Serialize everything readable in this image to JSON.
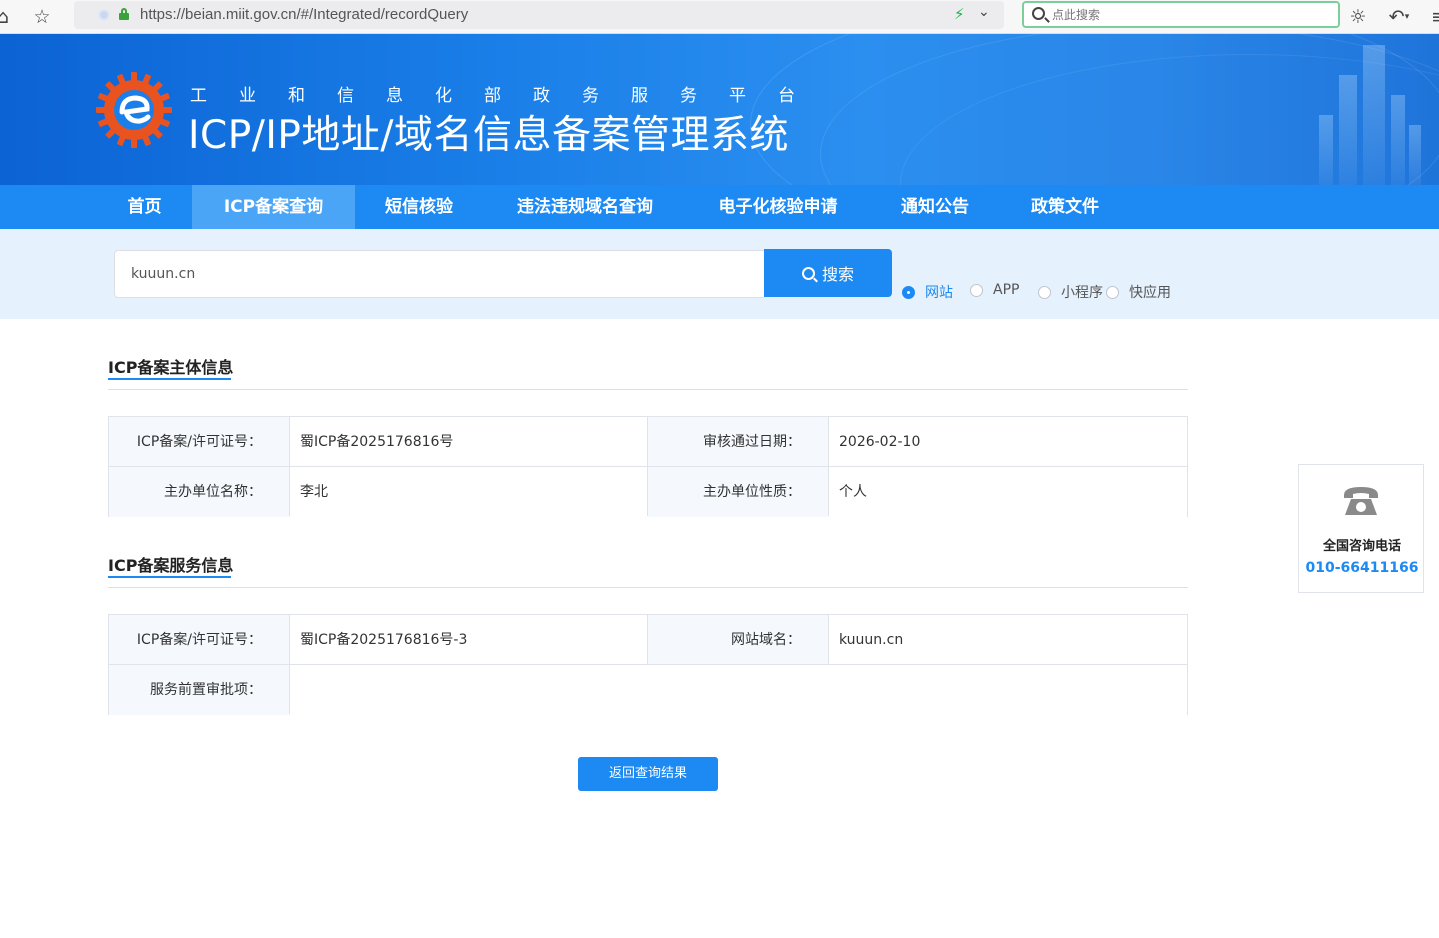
{
  "browser": {
    "url": "https://beian.miit.gov.cn/#/Integrated/recordQuery",
    "search_placeholder": "点此搜索"
  },
  "header": {
    "subtitle": "工业和信息化部政务服务平台",
    "title": "ICP/IP地址/域名信息备案管理系统"
  },
  "nav": {
    "items": [
      {
        "label": "首页"
      },
      {
        "label": "ICP备案查询"
      },
      {
        "label": "短信核验"
      },
      {
        "label": "违法违规域名查询"
      },
      {
        "label": "电子化核验申请"
      },
      {
        "label": "通知公告"
      },
      {
        "label": "政策文件"
      }
    ],
    "active": "ICP备案查询"
  },
  "search": {
    "value": "kuuun.cn",
    "button_label": "搜索",
    "options": [
      {
        "label": "网站",
        "checked": true
      },
      {
        "label": "APP",
        "checked": false
      },
      {
        "label": "小程序",
        "checked": false
      },
      {
        "label": "快应用",
        "checked": false
      }
    ]
  },
  "entity_section": {
    "title": "ICP备案主体信息",
    "rows": [
      {
        "label1": "ICP备案/许可证号：",
        "value1": "蜀ICP备2025176816号",
        "label2": "审核通过日期：",
        "value2": "2026-02-10"
      },
      {
        "label1": "主办单位名称：",
        "value1": "李北",
        "label2": "主办单位性质：",
        "value2": "个人"
      }
    ]
  },
  "service_section": {
    "title": "ICP备案服务信息",
    "row1": {
      "label1": "ICP备案/许可证号：",
      "value1": "蜀ICP备2025176816号-3",
      "label2": "网站域名：",
      "value2": "kuuun.cn"
    },
    "row2": {
      "label1": "服务前置审批项：",
      "value1": ""
    }
  },
  "back_button_label": "返回查询结果",
  "contact": {
    "label": "全国咨询电话",
    "phone": "010-66411166"
  },
  "colors": {
    "primary": "#1c8af2",
    "nav_active": "#4aa5f6",
    "search_bg": "#e5f1fc",
    "label_bg": "#f5f9fd"
  }
}
